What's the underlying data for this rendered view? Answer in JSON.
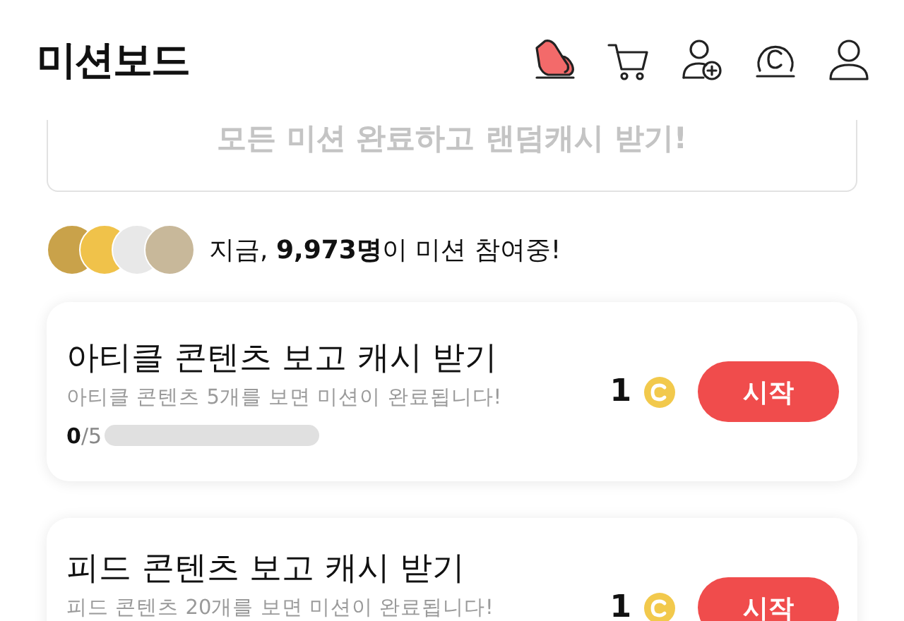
{
  "header": {
    "title": "미션보드"
  },
  "banner": {
    "text": "모든 미션 완료하고 랜덤캐시 받기!"
  },
  "participants": {
    "text": "지금, **9,973명**이 미션 참여중!"
  },
  "missions": [
    {
      "title": "아티클 콘텐츠 보고 캐시 받기",
      "description": "아티클 콘텐츠 5개를 보면 미션이 완료됩니다!",
      "progress": "**0**/5",
      "level": 0,
      "reward": "1",
      "button": "시작"
    },
    {
      "title": "피드 콘텐츠 보고 캐시 받기",
      "description": "피드 콘텐츠 20개를 보면 미션이 완료됩니다!",
      "reward": "1",
      "button": "시작"
    }
  ]
}
